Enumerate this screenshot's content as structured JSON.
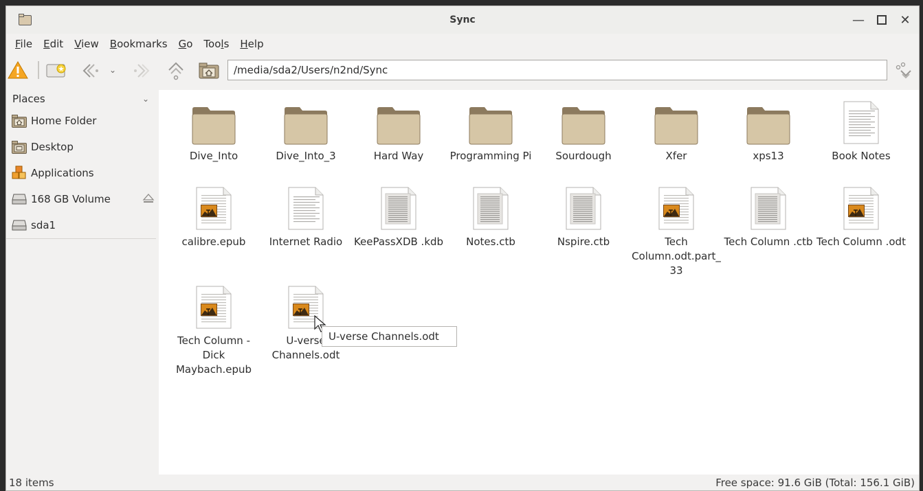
{
  "window": {
    "title": "Sync"
  },
  "menu": [
    {
      "label": "File",
      "accel": "F",
      "rest": "ile"
    },
    {
      "label": "Edit",
      "accel": "E",
      "rest": "dit"
    },
    {
      "label": "View",
      "accel": "V",
      "rest": "iew"
    },
    {
      "label": "Bookmarks",
      "accel": "B",
      "rest": "ookmarks"
    },
    {
      "label": "Go",
      "accel": "G",
      "rest": "o"
    },
    {
      "label": "Tools",
      "pre": "Too",
      "accel": "l",
      "rest": "s"
    },
    {
      "label": "Help",
      "accel": "H",
      "rest": "elp"
    }
  ],
  "toolbar": {
    "path": "/media/sda2/Users/n2nd/Sync",
    "icons": [
      "warning-icon",
      "new-tab-icon",
      "back-icon",
      "dropdown-icon",
      "forward-icon",
      "up-icon",
      "home-icon",
      "clear-icon"
    ]
  },
  "sidebar": {
    "header": "Places",
    "items": [
      {
        "label": "Home Folder",
        "icon": "home-folder-icon"
      },
      {
        "label": "Desktop",
        "icon": "desktop-folder-icon"
      },
      {
        "label": "Applications",
        "icon": "applications-icon"
      },
      {
        "label": "168 GB Volume",
        "icon": "drive-icon",
        "eject": true
      },
      {
        "label": "sda1",
        "icon": "drive-icon"
      }
    ]
  },
  "files": [
    {
      "name": "Dive_Into",
      "type": "folder"
    },
    {
      "name": "Dive_Into_3",
      "type": "folder"
    },
    {
      "name": "Hard Way",
      "type": "folder"
    },
    {
      "name": "Programming Pi",
      "type": "folder"
    },
    {
      "name": "Sourdough",
      "type": "folder"
    },
    {
      "name": "Xfer",
      "type": "folder"
    },
    {
      "name": "xps13",
      "type": "folder"
    },
    {
      "name": "Book Notes",
      "type": "text"
    },
    {
      "name": "calibre.epub",
      "type": "image-doc"
    },
    {
      "name": "Internet Radio",
      "type": "text"
    },
    {
      "name": "KeePassXDB .kdb",
      "type": "doc"
    },
    {
      "name": "Notes.ctb",
      "type": "doc"
    },
    {
      "name": "Nspire.ctb",
      "type": "doc"
    },
    {
      "name": "Tech Column.odt.part_33",
      "type": "image-doc"
    },
    {
      "name": "Tech Column .ctb",
      "type": "doc"
    },
    {
      "name": "Tech Column .odt",
      "type": "image-doc"
    },
    {
      "name": "Tech Column - Dick Maybach.epub",
      "type": "image-doc"
    },
    {
      "name": "U-verse Channels.odt",
      "type": "image-doc"
    }
  ],
  "tooltip": "U-verse Channels.odt",
  "status": {
    "count": "18 items",
    "free": "Free space: 91.6 GiB (Total: 156.1 GiB)"
  }
}
